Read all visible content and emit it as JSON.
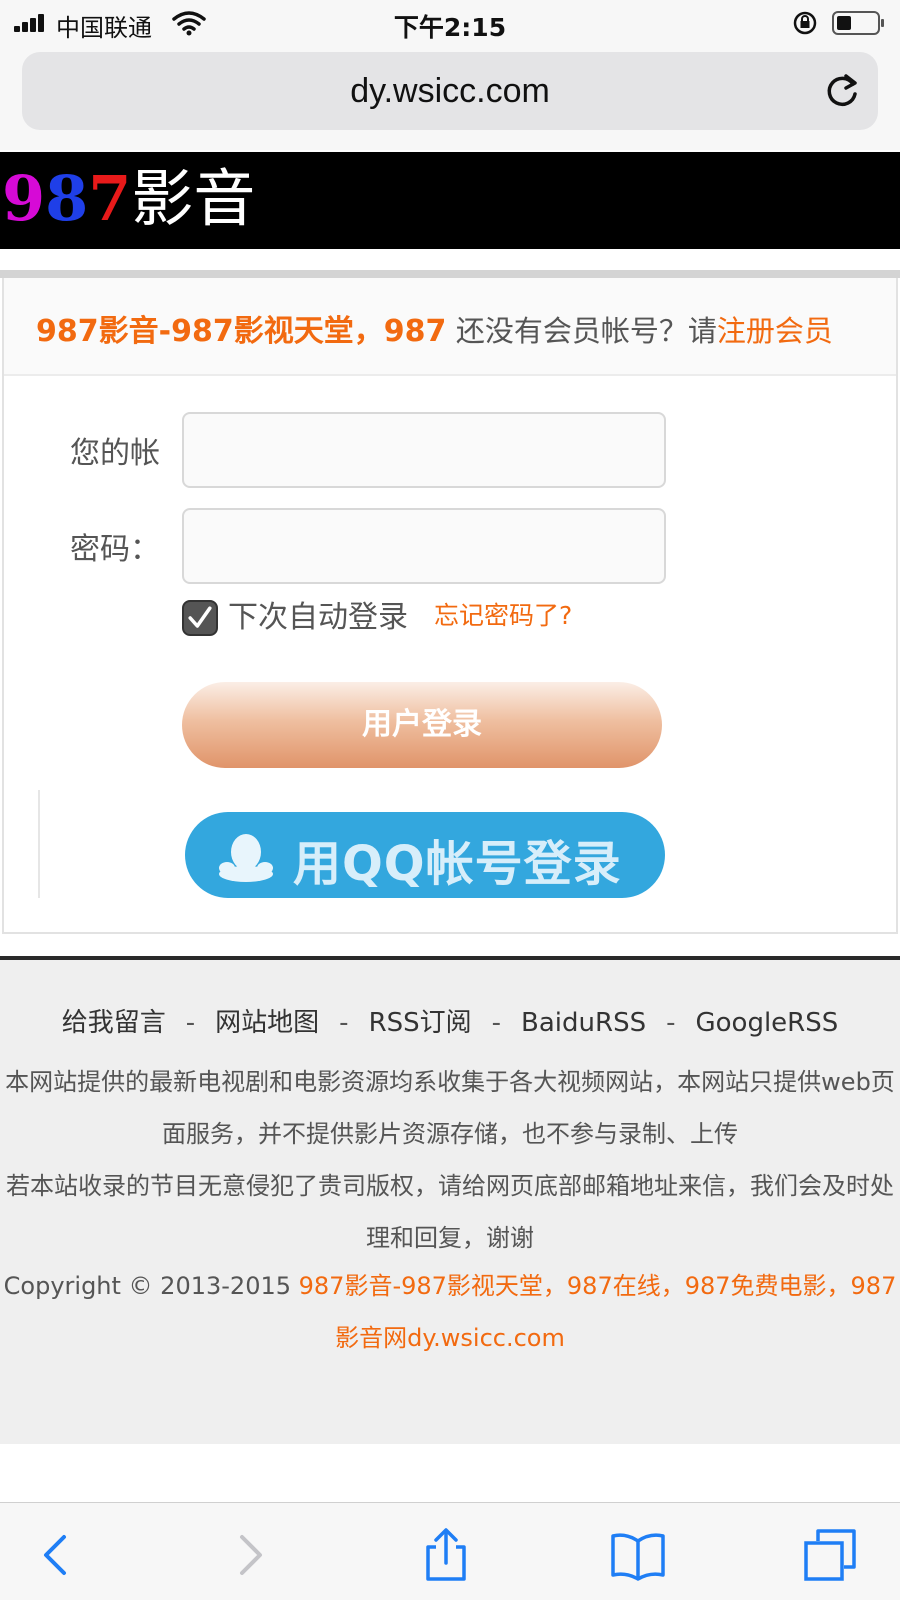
{
  "status_bar": {
    "carrier": "中国联通",
    "time": "下午2:15"
  },
  "browser": {
    "url": "dy.wsicc.com"
  },
  "header": {
    "logo_digit_1": "9",
    "logo_digit_2": "8",
    "logo_digit_3": "7",
    "logo_word": "影音",
    "colors": {
      "digit_1": "#d60ad6",
      "digit_2": "#1f3fe8",
      "digit_3": "#e81a1a",
      "background": "#000000"
    }
  },
  "login": {
    "site_name": "987影音-987影视天堂，987",
    "no_account_text": "还没有会员帐号？请",
    "register_link": "注册会员",
    "account_label": "您的帐",
    "account_value": "",
    "password_label": "密码：",
    "password_value": "",
    "remember_label": "下次自动登录",
    "remember_checked": true,
    "forgot_link": "忘记密码了?",
    "login_button": "用户登录",
    "qq_button": "用QQ帐号登录",
    "accent_color": "#f26a10"
  },
  "footer": {
    "links": [
      "给我留言",
      "网站地图",
      "RSS订阅",
      "BaiduRSS",
      "GoogleRSS"
    ],
    "separator": "-",
    "disclaimer_1": "本网站提供的最新电视剧和电影资源均系收集于各大视频网站，本网站只提供web页面服务，并不提供影片资源存储，也不参与录制、上传",
    "disclaimer_2": "若本站收录的节目无意侵犯了贵司版权，请给网页底部邮箱地址来信，我们会及时处理和回复，谢谢",
    "copyright_prefix": "Copyright © 2013-2015 ",
    "copyright_link": "987影音-987影视天堂，987在线，987免费电影，987影音网dy.wsicc.com"
  },
  "toolbar": {
    "icons": [
      "back-icon",
      "forward-icon",
      "share-icon",
      "bookmarks-icon",
      "tabs-icon"
    ]
  }
}
